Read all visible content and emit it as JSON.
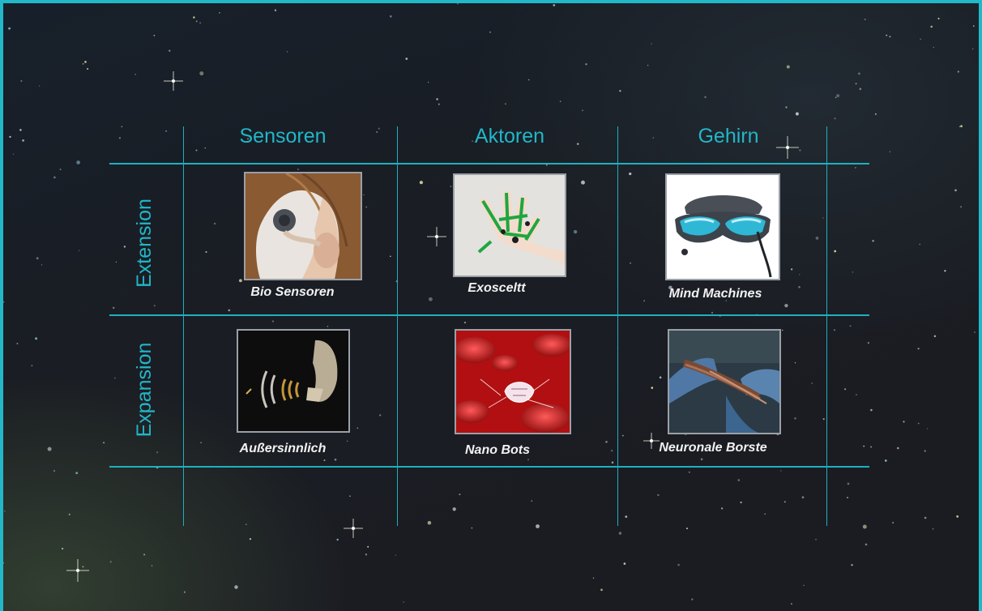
{
  "columns": [
    {
      "label": "Sensoren"
    },
    {
      "label": "Aktoren"
    },
    {
      "label": "Gehirn"
    }
  ],
  "rows": [
    {
      "label": "Extension"
    },
    {
      "label": "Expansion"
    }
  ],
  "cells": [
    {
      "caption": "Bio Sensoren",
      "image": "cochlear-implant-icon"
    },
    {
      "caption": "Exosceltt",
      "image": "exoskeleton-hand-icon"
    },
    {
      "caption": "Mind Machines",
      "image": "vr-headset-icon"
    },
    {
      "caption": "Außersinnlich",
      "image": "bat-echolocation-icon"
    },
    {
      "caption": "Nano Bots",
      "image": "nanobot-blood-icon"
    },
    {
      "caption": "Neuronale Borste",
      "image": "neural-braid-icon"
    }
  ],
  "colors": {
    "accent": "#22b6c8",
    "background": "#1b1c22",
    "caption": "#f2f2f2"
  }
}
